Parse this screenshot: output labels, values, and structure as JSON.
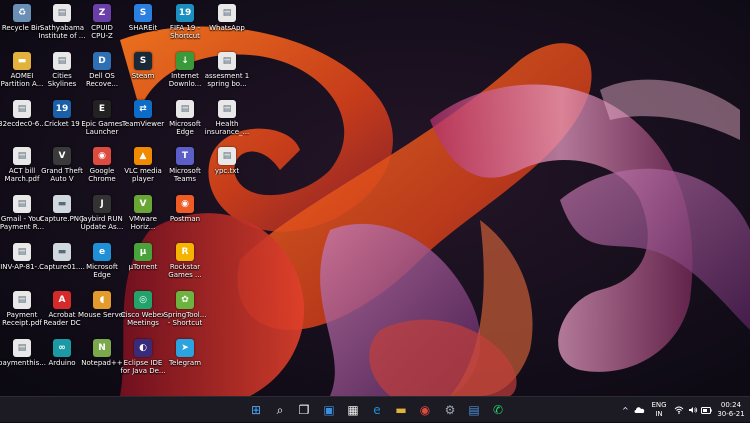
{
  "desktop": {
    "columns": [
      [
        {
          "label": "Recycle Bin",
          "icon": "recycle-bin-icon",
          "glyph": "♻",
          "color": "#6a8fb5"
        },
        {
          "label": "AOMEI\nPartition A...",
          "icon": "folder-icon",
          "glyph": "▬",
          "color": "#e2b33c"
        },
        {
          "label": "32ecdec0-6...",
          "icon": "file-icon",
          "glyph": "▤",
          "color": "#e8e8e8"
        },
        {
          "label": "ACT bill\nMarch.pdf",
          "icon": "pdf-file-icon",
          "glyph": "▤",
          "color": "#e8e8e8"
        },
        {
          "label": "Gmail - Your\nPayment R...",
          "icon": "file-icon",
          "glyph": "▤",
          "color": "#e8e8e8"
        },
        {
          "label": "INV-AP-81-...",
          "icon": "file-icon",
          "glyph": "▤",
          "color": "#e8e8e8"
        },
        {
          "label": "Payment\nReceipt.pdf",
          "icon": "pdf-file-icon",
          "glyph": "▤",
          "color": "#e8e8e8"
        },
        {
          "label": "paymenthis...",
          "icon": "file-icon",
          "glyph": "▤",
          "color": "#e8e8e8"
        }
      ],
      [
        {
          "label": "Sathyabama\nInstitute of ...",
          "icon": "file-icon",
          "glyph": "▤",
          "color": "#e8e8e8"
        },
        {
          "label": "Cities\nSkylines",
          "icon": "file-icon",
          "glyph": "▤",
          "color": "#e8e8e8"
        },
        {
          "label": "Cricket 19",
          "icon": "cricket-19-icon",
          "glyph": "19",
          "color": "#1a5fa8"
        },
        {
          "label": "Grand Theft\nAuto V",
          "icon": "gta-v-icon",
          "glyph": "V",
          "color": "#3a3a3a"
        },
        {
          "label": "Capture.PNG",
          "icon": "image-file-icon",
          "glyph": "▬",
          "color": "#cfd8dc"
        },
        {
          "label": "Capture01....",
          "icon": "image-file-icon",
          "glyph": "▬",
          "color": "#cfd8dc"
        },
        {
          "label": "Acrobat\nReader DC",
          "icon": "acrobat-icon",
          "glyph": "A",
          "color": "#d42a2a"
        },
        {
          "label": "Arduino",
          "icon": "arduino-icon",
          "glyph": "∞",
          "color": "#1b9aa5"
        }
      ],
      [
        {
          "label": "CPUID\nCPU-Z",
          "icon": "cpu-z-icon",
          "glyph": "Z",
          "color": "#6b3fa8"
        },
        {
          "label": "Dell OS\nRecove...",
          "icon": "dell-recovery-icon",
          "glyph": "D",
          "color": "#2f6fb4"
        },
        {
          "label": "Epic Games\nLauncher",
          "icon": "epic-games-icon",
          "glyph": "E",
          "color": "#222222"
        },
        {
          "label": "Google\nChrome",
          "icon": "chrome-icon",
          "glyph": "◉",
          "color": "#dd4b3e"
        },
        {
          "label": "Jaybird RUN\nUpdate As...",
          "icon": "jaybird-icon",
          "glyph": "J",
          "color": "#333333"
        },
        {
          "label": "Microsoft\nEdge",
          "icon": "edge-icon",
          "glyph": "e",
          "color": "#1f8fd6"
        },
        {
          "label": "Mouse Server",
          "icon": "mouse-server-icon",
          "glyph": "◖",
          "color": "#e39b2b"
        },
        {
          "label": "Notepad++",
          "icon": "notepad-plus-icon",
          "glyph": "N",
          "color": "#7aa84b"
        }
      ],
      [
        {
          "label": "SHAREit",
          "icon": "shareit-icon",
          "glyph": "S",
          "color": "#2a7fe0"
        },
        {
          "label": "Steam",
          "icon": "steam-icon",
          "glyph": "S",
          "color": "#1b2838"
        },
        {
          "label": "TeamViewer",
          "icon": "teamviewer-icon",
          "glyph": "⇄",
          "color": "#0e6cc9"
        },
        {
          "label": "VLC media\nplayer",
          "icon": "vlc-icon",
          "glyph": "▲",
          "color": "#f08a00"
        },
        {
          "label": "VMware\nHoriz...",
          "icon": "vmware-icon",
          "glyph": "V",
          "color": "#6aa636"
        },
        {
          "label": "µTorrent",
          "icon": "utorrent-icon",
          "glyph": "µ",
          "color": "#4aa33a"
        },
        {
          "label": "Cisco Webex\nMeetings",
          "icon": "webex-icon",
          "glyph": "◎",
          "color": "#22a36b"
        },
        {
          "label": "Eclipse IDE\nfor Java De...",
          "icon": "eclipse-icon",
          "glyph": "◐",
          "color": "#3b2a7a"
        }
      ],
      [
        {
          "label": "FIFA 19 -\nShortcut",
          "icon": "fifa-19-icon",
          "glyph": "19",
          "color": "#1a8fc0"
        },
        {
          "label": "Internet\nDownlo...",
          "icon": "internet-download-manager-icon",
          "glyph": "↓",
          "color": "#3a9a3a"
        },
        {
          "label": "Microsoft\nEdge",
          "icon": "file-icon",
          "glyph": "▤",
          "color": "#e8e8e8"
        },
        {
          "label": "Microsoft\nTeams",
          "icon": "teams-icon",
          "glyph": "T",
          "color": "#5b5fc7"
        },
        {
          "label": "Postman",
          "icon": "postman-icon",
          "glyph": "◉",
          "color": "#ef5b25"
        },
        {
          "label": "Rockstar\nGames ...",
          "icon": "rockstar-games-icon",
          "glyph": "R",
          "color": "#f5b400"
        },
        {
          "label": "SpringTool...\n- Shortcut",
          "icon": "spring-tool-icon",
          "glyph": "✿",
          "color": "#6db33f"
        },
        {
          "label": "Telegram",
          "icon": "telegram-icon",
          "glyph": "➤",
          "color": "#2aa3e0"
        }
      ],
      [
        {
          "label": "WhatsApp",
          "icon": "file-icon",
          "glyph": "▤",
          "color": "#e8e8e8"
        },
        {
          "label": "assesment 1\nspring bo...",
          "icon": "file-icon",
          "glyph": "▤",
          "color": "#e8e8e8"
        },
        {
          "label": "Health\ninsurance_...",
          "icon": "file-icon",
          "glyph": "▤",
          "color": "#e8e8e8"
        },
        {
          "label": "ypc.txt",
          "icon": "text-file-icon",
          "glyph": "▤",
          "color": "#e8e8e8"
        }
      ]
    ]
  },
  "taskbar": {
    "pinned": [
      {
        "name": "start-icon",
        "glyph": "⊞",
        "color": "#4aa3f0"
      },
      {
        "name": "search-icon",
        "glyph": "⌕",
        "color": "#ffffff"
      },
      {
        "name": "task-view-icon",
        "glyph": "❐",
        "color": "#ffffff"
      },
      {
        "name": "widgets-icon",
        "glyph": "▣",
        "color": "#3a8fe0"
      },
      {
        "name": "microsoft-store-icon",
        "glyph": "▦",
        "color": "#f0f0f0"
      },
      {
        "name": "edge-icon",
        "glyph": "e",
        "color": "#1f8fd6"
      },
      {
        "name": "file-explorer-icon",
        "glyph": "▬",
        "color": "#e2b33c"
      },
      {
        "name": "chrome-icon",
        "glyph": "◉",
        "color": "#dd4b3e"
      },
      {
        "name": "settings-icon",
        "glyph": "⚙",
        "color": "#9aa8b8"
      },
      {
        "name": "notepad-icon",
        "glyph": "▤",
        "color": "#4a8fd8"
      },
      {
        "name": "whatsapp-icon",
        "glyph": "✆",
        "color": "#25d366"
      }
    ],
    "tray": {
      "chevron": "^",
      "lang_line1": "ENG",
      "lang_line2": "IN",
      "time": "00:24",
      "date": "30-6-21"
    }
  }
}
